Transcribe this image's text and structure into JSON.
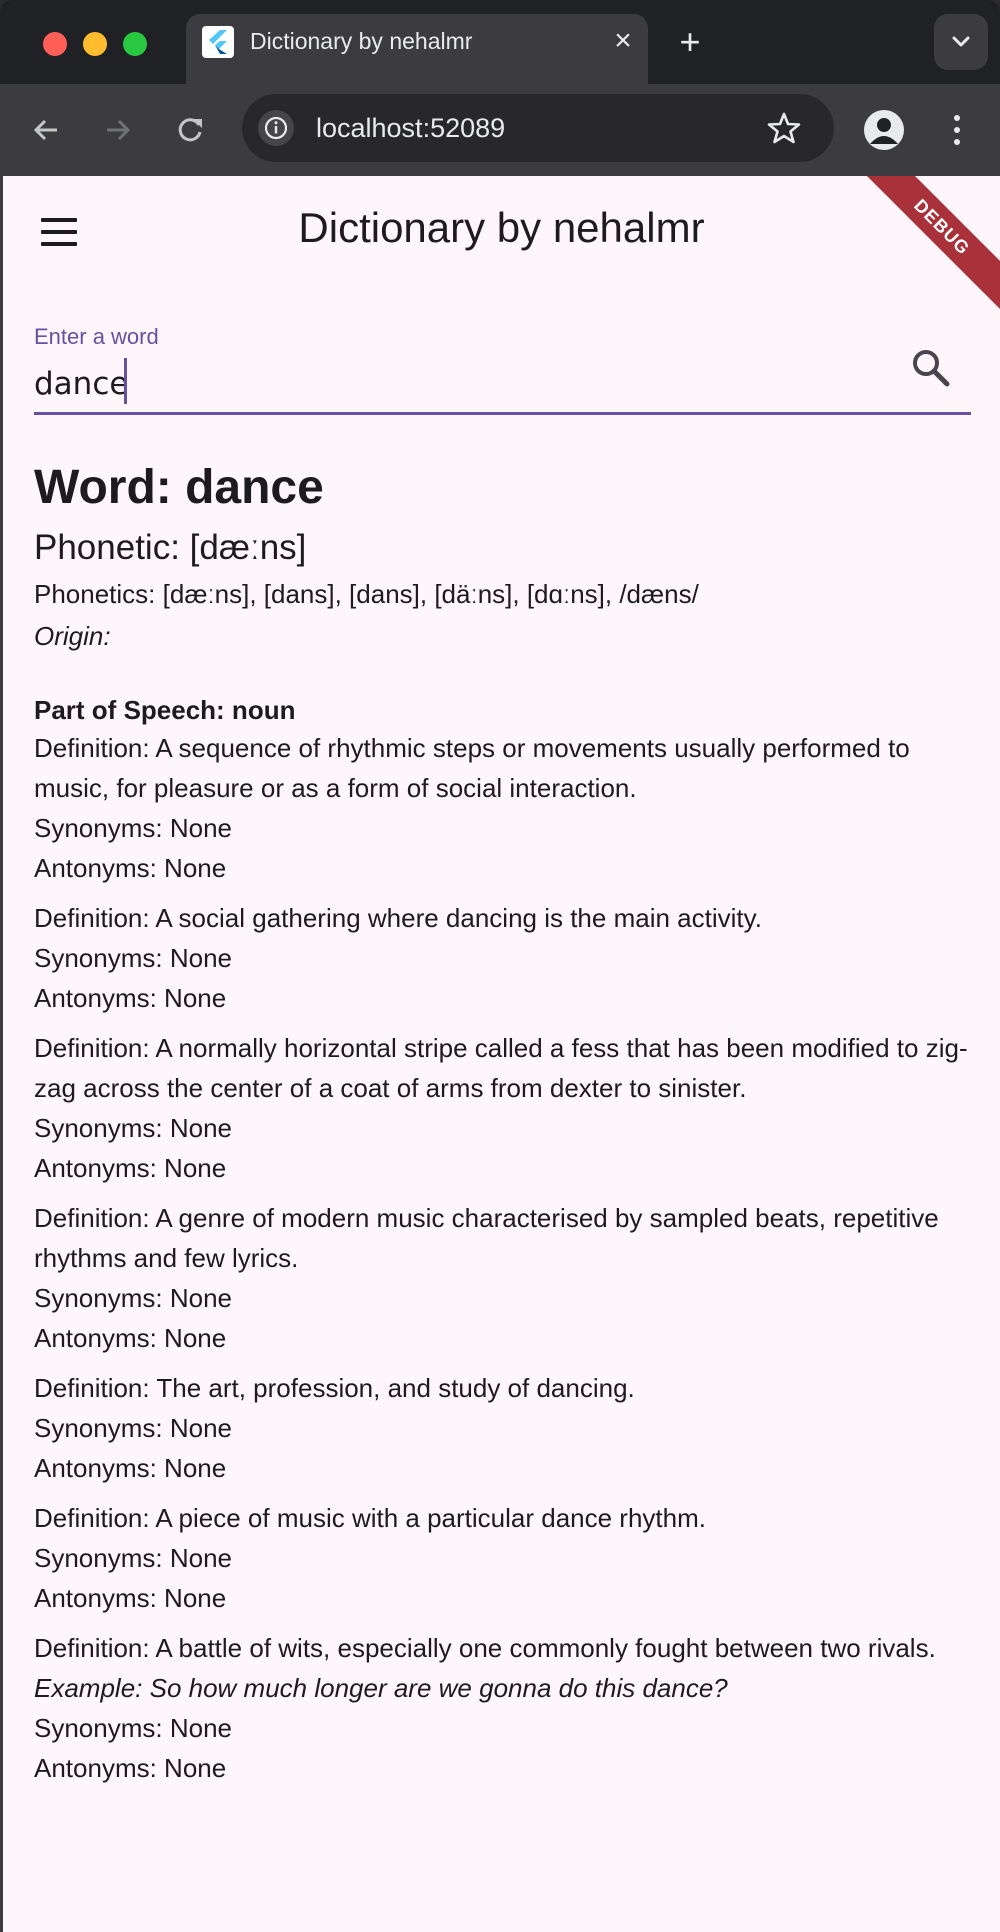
{
  "browser": {
    "tab_title": "Dictionary by nehalmr",
    "tab_close_glyph": "×",
    "new_tab_glyph": "+",
    "url": "localhost:52089"
  },
  "app": {
    "title": "Dictionary by nehalmr",
    "debug_banner": "DEBUG",
    "search": {
      "label": "Enter a word",
      "value": "dance"
    }
  },
  "entry": {
    "word_line": "Word: dance",
    "phonetic_line": "Phonetic: [dæːns]",
    "phonetics_line": "Phonetics: [dæːns], [dans], [dans], [däːns], [dɑːns], /dæns/",
    "origin_line": "Origin:",
    "part_of_speech_line": "Part of Speech: noun",
    "meanings": [
      {
        "definition": "Definition: A sequence of rhythmic steps or movements usually performed to music, for pleasure or as a form of social interaction.",
        "synonyms": "Synonyms: None",
        "antonyms": "Antonyms: None"
      },
      {
        "definition": "Definition: A social gathering where dancing is the main activity.",
        "synonyms": "Synonyms: None",
        "antonyms": "Antonyms: None"
      },
      {
        "definition": "Definition: A normally horizontal stripe called a fess that has been modified to zig-zag across the center of a coat of arms from dexter to sinister.",
        "synonyms": "Synonyms: None",
        "antonyms": "Antonyms: None"
      },
      {
        "definition": "Definition: A genre of modern music characterised by sampled beats, repetitive rhythms and few lyrics.",
        "synonyms": "Synonyms: None",
        "antonyms": "Antonyms: None"
      },
      {
        "definition": "Definition: The art, profession, and study of dancing.",
        "synonyms": "Synonyms: None",
        "antonyms": "Antonyms: None"
      },
      {
        "definition": "Definition: A piece of music with a particular dance rhythm.",
        "synonyms": "Synonyms: None",
        "antonyms": "Antonyms: None"
      },
      {
        "definition": "Definition: A battle of wits, especially one commonly fought between two rivals.",
        "example": "Example: So how much longer are we gonna do this dance?",
        "synonyms": "Synonyms: None",
        "antonyms": "Antonyms: None"
      }
    ]
  },
  "icons": {
    "window_controls": [
      "close-traffic-light",
      "minimize-traffic-light",
      "zoom-traffic-light"
    ],
    "toolbar": [
      "back-arrow-icon",
      "forward-arrow-icon",
      "reload-icon",
      "info-icon",
      "star-icon",
      "profile-icon",
      "kebab-menu-icon"
    ],
    "app": [
      "hamburger-menu-icon",
      "search-icon"
    ]
  },
  "colors": {
    "accent": "#6750a4",
    "page_background": "#fdf7fc",
    "debug_banner": "#a8313a",
    "browser_chrome": "#3c3c40",
    "tab_strip": "#202124"
  }
}
